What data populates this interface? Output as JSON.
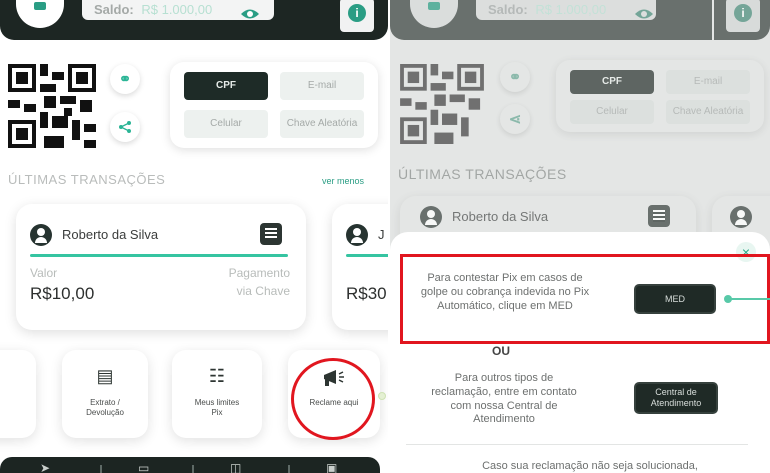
{
  "left": {
    "saldo_label": "Saldo:",
    "saldo_value": "R$ 1.000,00",
    "pix_keys": {
      "cpf": "CPF",
      "email": "E-mail",
      "celular": "Celular",
      "chave": "Chave Aleatória"
    },
    "section_title": "ÚLTIMAS TRANSAÇÕES",
    "ver_menos": "ver menos",
    "tx1": {
      "name": "Roberto da Silva",
      "valor_label": "Valor",
      "valor": "R$10,00",
      "pagamento_label": "Pagamento",
      "pagamento_via": "via Chave"
    },
    "tx2": {
      "valor_partial": "R$30"
    },
    "actions": {
      "extrato": "Extrato / Devolução",
      "limites": "Meus limites Pix",
      "reclame": "Reclame aqui"
    }
  },
  "right": {
    "saldo_label": "Saldo:",
    "saldo_value": "R$ 1.000,00",
    "pix_keys": {
      "cpf": "CPF",
      "email": "E-mail",
      "celular": "Celular",
      "chave": "Chave Aleatória"
    },
    "section_title": "ÚLTIMAS TRANSAÇÕES",
    "tx1_name": "Roberto da Silva",
    "sheet": {
      "med_text": "Para contestar Pix em casos de golpe ou cobrança indevida no Pix Automático, clique em MED",
      "med_button": "MED",
      "ou": "OU",
      "central_text": "Para outros tipos de reclamação, entre em contato com nossa Central de Atendimento",
      "central_button": "Central de Atendimento",
      "footer_text": "Caso sua reclamação não seja solucionada,"
    }
  },
  "colors": {
    "accent": "#2a9d84",
    "dark": "#1d2623",
    "highlight": "#e1161f"
  }
}
